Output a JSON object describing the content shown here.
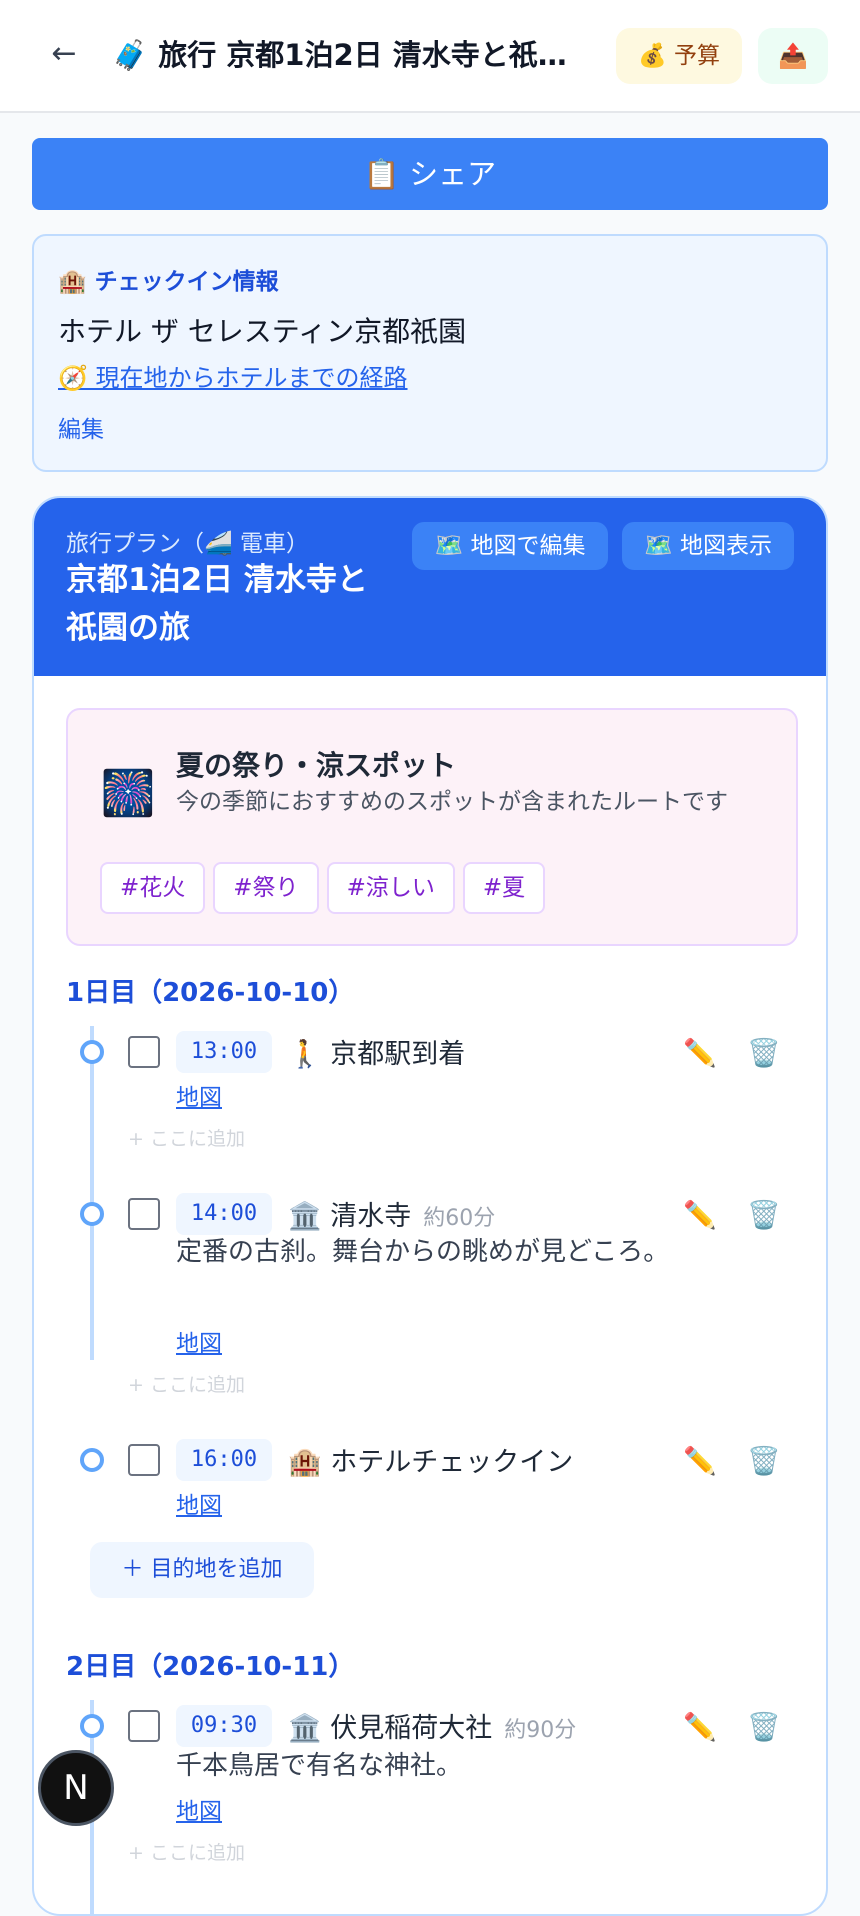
{
  "header": {
    "back_label": "←",
    "title": "🧳 旅行 京都1泊2日 清水寺と祇園...",
    "budget_label": "💰 予算",
    "export_label": "📤"
  },
  "share_label": "📋 シェア",
  "checkin": {
    "label": "🏨 チェックイン情報",
    "hotel": "ホテル ザ セレスティン京都祇園",
    "route": "🧭 現在地からホテルまでの経路",
    "edit": "編集"
  },
  "plan": {
    "subtitle": "旅行プラン（🚄 電車）",
    "title": "京都1泊2日 清水寺と祇園の旅",
    "map_edit": "🗺️ 地図で編集",
    "map_view": "🗺️ 地図表示",
    "season": {
      "icon": "🎆",
      "title": "夏の祭り・涼スポット",
      "desc": "今の季節におすすめのスポットが含まれたルートです",
      "tags": [
        "#花火",
        "#祭り",
        "#涼しい",
        "#夏"
      ]
    },
    "days": [
      {
        "label": "1日目（2026-10-10）",
        "items": [
          {
            "time": "13:00",
            "title": "🚶 京都駅到着",
            "duration": "",
            "desc": "",
            "map": "地図"
          },
          {
            "time": "14:00",
            "title": "🏛️ 清水寺",
            "duration": "約60分",
            "desc": "定番の古刹。舞台からの眺めが見どころ。",
            "map": "地図"
          },
          {
            "time": "16:00",
            "title": "🏨 ホテルチェックイン",
            "duration": "",
            "desc": "",
            "map": "地図"
          }
        ],
        "add_dest": "＋ 目的地を追加"
      },
      {
        "label": "2日目（2026-10-11）",
        "items": [
          {
            "time": "09:30",
            "title": "🏛️ 伏見稲荷大社",
            "duration": "約90分",
            "desc": "千本鳥居で有名な神社。",
            "map": "地図"
          }
        ]
      }
    ],
    "add_here": "+ ここに追加",
    "edit_icon": "✏️",
    "trash_icon": "🗑️"
  },
  "fab_label": "N"
}
